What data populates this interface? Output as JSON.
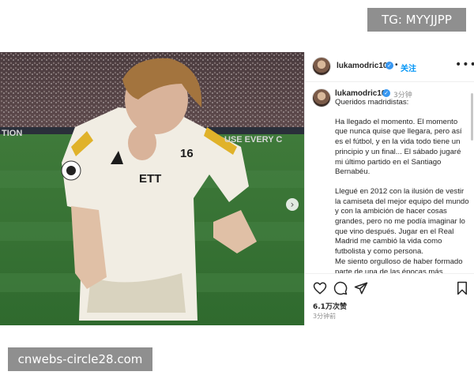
{
  "watermarks": {
    "top_right": "TG: MYYJJPP",
    "bottom_left": "cnwebs-circle28.com"
  },
  "photo": {
    "banner_left": "TION",
    "banner_right": "USE EVERY C",
    "jersey_number": "16",
    "sponsor": "ETT",
    "carousel_arrow": "›"
  },
  "post_header": {
    "username": "lukamodric10",
    "verified_mark": "✓",
    "separator": "•",
    "follow_label": "关注",
    "more": "•••"
  },
  "caption": {
    "username": "lukamodric10",
    "verified_mark": "✓",
    "time_ago": "3分钟",
    "paragraphs": [
      "Queridos madridistas:",
      "Ha llegado el momento. El momento que nunca quise que llegara, pero así es el fútbol, y en la vida todo tiene un principio y un final... El sábado jugaré mi último partido en el Santiago Bernabéu.",
      "Llegué en 2012 con la ilusión de vestir la camiseta del mejor equipo del mundo y con la ambición de hacer cosas grandes, pero no me podía imaginar lo que vino después. Jugar en el Real Madrid me cambió la vida como futbolista y como persona.",
      "Me siento orgulloso de haber formado parte de una de las épocas más exitosas del mejor club de la"
    ]
  },
  "actions": {
    "icons": [
      "heart-icon",
      "comment-icon",
      "share-icon",
      "bookmark-icon"
    ],
    "likes": "6.1万次赞",
    "post_time": "3分钟前"
  },
  "colors": {
    "link_blue": "#0095f6",
    "verified_blue": "#3897f0",
    "watermark_gray": "#8f8f8f"
  }
}
